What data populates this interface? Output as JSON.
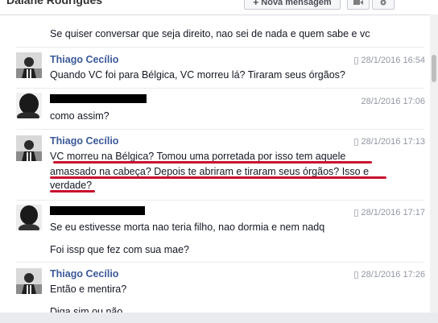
{
  "header": {
    "title": "Daiane Rodrigues",
    "new_message_label": "Nova mensagem",
    "new_message_icon": "plus-icon",
    "video_icon": "video-camera-icon",
    "settings_icon": "gear-icon"
  },
  "top_message": "Se quiser conversar que seja direito, nao sei de nada e quem sabe e vc",
  "groups": [
    {
      "sender": "Thiago Cecílio",
      "time": "28/1/2016 16:54",
      "mobile": true,
      "lines": [
        "Quando VC foi para Bélgica, VC morreu lá? Tiraram seus órgãos?"
      ]
    },
    {
      "sender": "",
      "time": "28/1/2016 17:06",
      "mobile": false,
      "lines": [
        "como assim?"
      ]
    },
    {
      "sender": "Thiago Cecílio",
      "time": "28/1/2016 17:13",
      "mobile": true,
      "lines": [
        "VC morreu na Bélgica? Tomou uma porretada por isso tem aquele",
        "amassado na cabeça? Depois te abriram e tiraram seus órgãos? Isso e",
        "verdade?"
      ]
    },
    {
      "sender": "",
      "time": "28/1/2016 17:17",
      "mobile": true,
      "lines": [
        "Se eu estivesse morta nao teria filho, nao dormia e nem nadq",
        "Foi issp que fez com sua mae?"
      ]
    },
    {
      "sender": "Thiago Cecílio",
      "time": "28/1/2016 17:26",
      "mobile": true,
      "lines": [
        "Então e mentira?",
        "Diga sim ou não"
      ]
    }
  ],
  "colors": {
    "sender_name": "#3b5998",
    "timestamp": "#9197a3",
    "underline_annotation": "#c8102e",
    "redaction": "#000000"
  }
}
